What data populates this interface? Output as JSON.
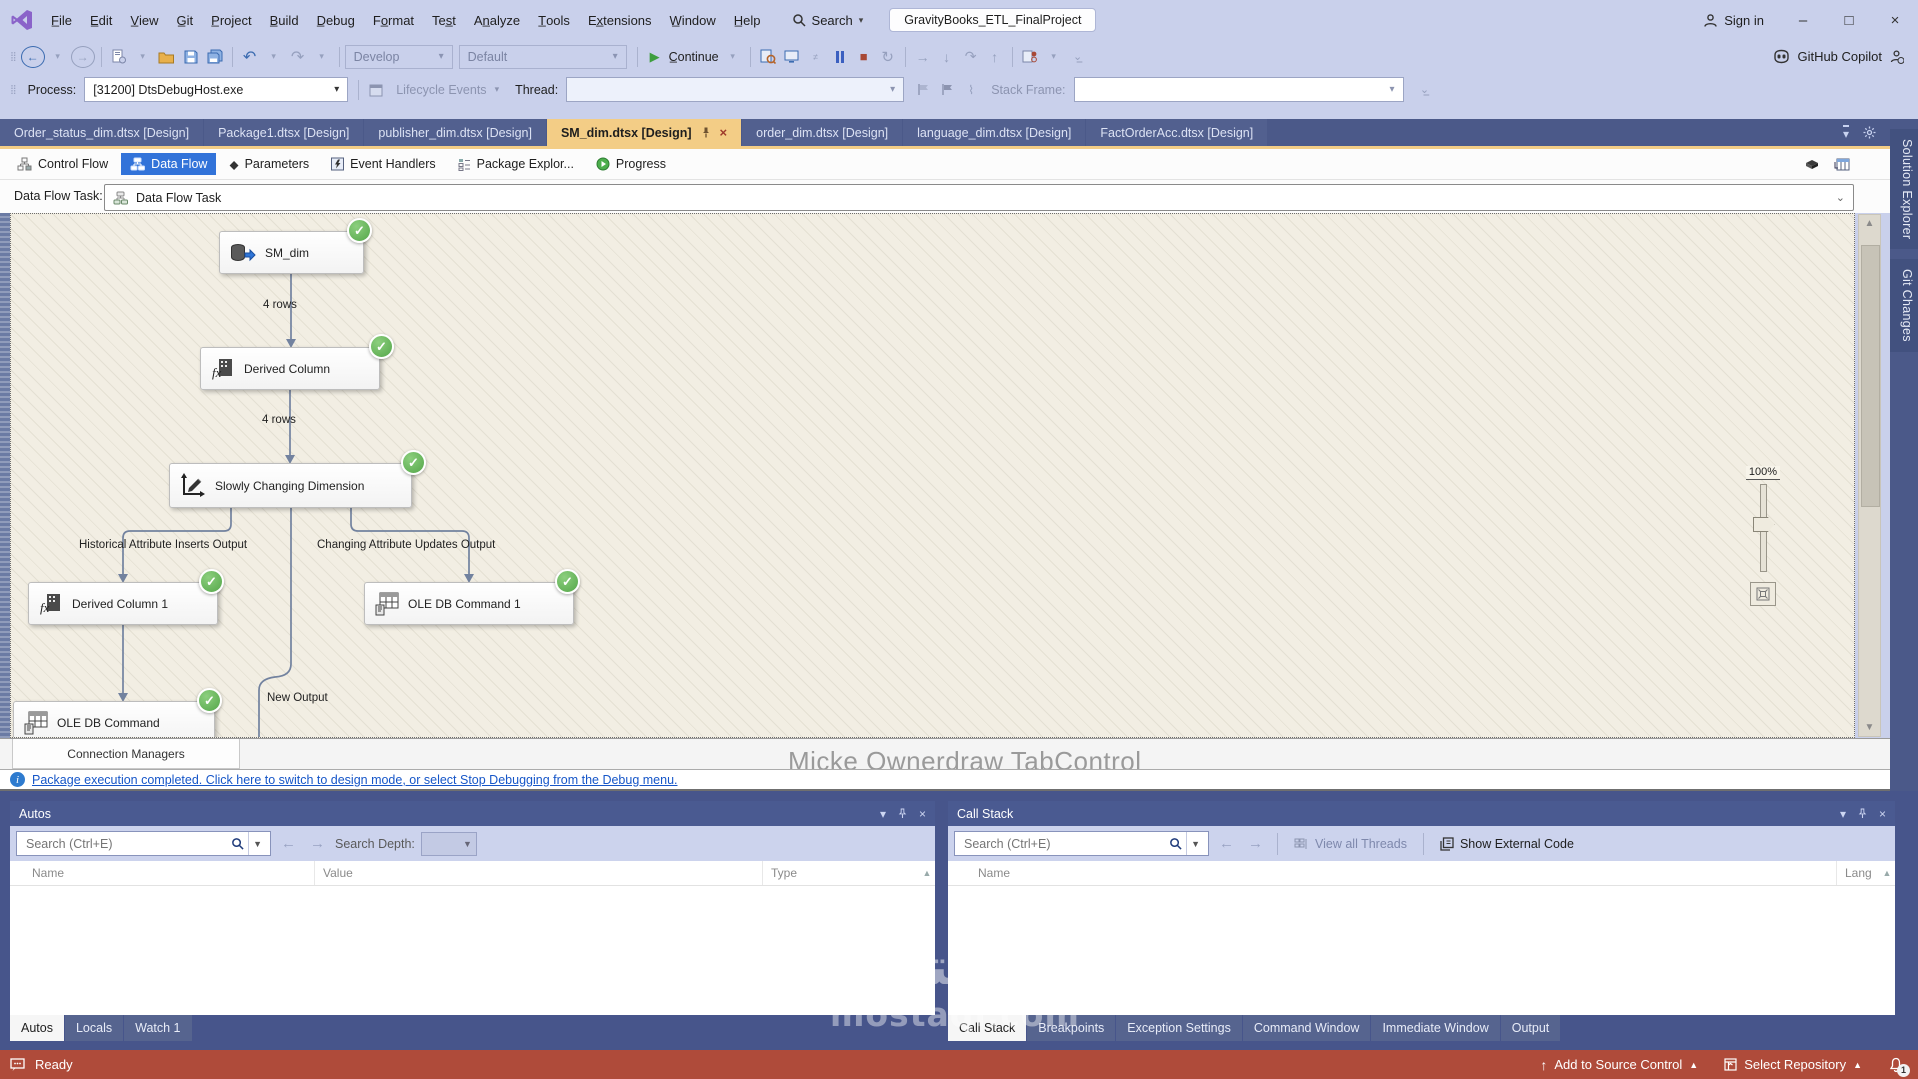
{
  "title_bar": {
    "menu": [
      "F̲ile",
      "E̲dit",
      "V̲iew",
      "G̲it",
      "P̲roject",
      "B̲uild",
      "D̲ebug",
      "Fo̲rmat",
      "Tes̲t",
      "An̲alyze",
      "T̲ools",
      "Ex̲tensions",
      "W̲indow",
      "H̲elp"
    ],
    "search_label": "Search",
    "solution_name": "GravityBooks_ETL_FinalProject",
    "sign_in_label": "Sign in",
    "copilot_label": "GitHub Copilot"
  },
  "toolbar": {
    "configuration": "Develop",
    "platform": "Default",
    "continue_label": "C̲ontinue"
  },
  "debug_bar": {
    "process_label": "Process:",
    "process_value": "[31200] DtsDebugHost.exe",
    "lifecycle_events_label": "Lifecycle Events",
    "thread_label": "Thread:",
    "stack_frame_label": "Stack Frame:"
  },
  "document_tabs": [
    {
      "label": "Order_status_dim.dtsx [Design]"
    },
    {
      "label": "Package1.dtsx [Design]"
    },
    {
      "label": "publisher_dim.dtsx [Design]"
    },
    {
      "label": "SM_dim.dtsx [Design]"
    },
    {
      "label": "order_dim.dtsx [Design]"
    },
    {
      "label": "language_dim.dtsx [Design]"
    },
    {
      "label": "FactOrderAcc.dtsx [Design]"
    }
  ],
  "designer": {
    "tabs": [
      {
        "label": "Control Flow"
      },
      {
        "label": "Data Flow"
      },
      {
        "label": "Parameters"
      },
      {
        "label": "Event Handlers"
      },
      {
        "label": "Package Explor..."
      },
      {
        "label": "Progress"
      }
    ],
    "task_selector_label": "Data Flow Task:",
    "task_selector_value": "Data Flow Task",
    "zoom_level": "100%",
    "connection_managers_label": "Connection Managers",
    "tabcontrol_watermark": "Micke Ownerdraw TabControl"
  },
  "flow": {
    "nodes": [
      {
        "label": "SM_dim"
      },
      {
        "label": "Derived Column"
      },
      {
        "label": "Slowly Changing Dimension"
      },
      {
        "label": "Derived Column 1"
      },
      {
        "label": "OLE DB Command 1"
      },
      {
        "label": "OLE DB Command"
      }
    ],
    "edge_labels": {
      "rows_1": "4 rows",
      "rows_2": "4 rows",
      "historical": "Historical Attribute Inserts Output",
      "changing": "Changing Attribute Updates Output",
      "new_output": "New Output"
    }
  },
  "info_bar": {
    "message": "Package execution completed. Click here to switch to design mode, or select Stop Debugging from the Debug menu."
  },
  "autos_panel": {
    "title": "Autos",
    "search_placeholder": "Search (Ctrl+E)",
    "search_depth_label": "Search Depth:",
    "columns": {
      "name": "Name",
      "value": "Value",
      "type": "Type"
    }
  },
  "call_stack_panel": {
    "title": "Call Stack",
    "search_placeholder": "Search (Ctrl+E)",
    "view_all_threads_label": "View all Threads",
    "show_external_code_label": "Show External Code",
    "columns": {
      "name": "Name",
      "lang": "Lang"
    }
  },
  "bottom_tabs_left": [
    {
      "label": "Autos"
    },
    {
      "label": "Locals"
    },
    {
      "label": "Watch 1"
    }
  ],
  "bottom_tabs_right": [
    {
      "label": "Call Stack"
    },
    {
      "label": "Breakpoints"
    },
    {
      "label": "Exception Settings"
    },
    {
      "label": "Command Window"
    },
    {
      "label": "Immediate Window"
    },
    {
      "label": "Output"
    }
  ],
  "status_bar": {
    "ready_label": "Ready",
    "add_to_source_control_label": "Add to Source Control",
    "select_repository_label": "Select Repository",
    "notification_count": "1"
  },
  "side_tabs": [
    {
      "label": "Solution Explorer"
    },
    {
      "label": "Git Changes"
    }
  ],
  "watermark": {
    "arabic": "مستقل",
    "latin": "mostaql.com"
  },
  "icons": {
    "check": "✓",
    "chevron_down": "▾",
    "close": "×",
    "minimize": "–",
    "maximize": "□"
  },
  "colors": {
    "active_tab": "#F3CD86",
    "selected_tab_blue": "#3273D9",
    "status_bar": "#AF4B3A",
    "success_green": "#54A649",
    "link_blue": "#1656C8"
  }
}
